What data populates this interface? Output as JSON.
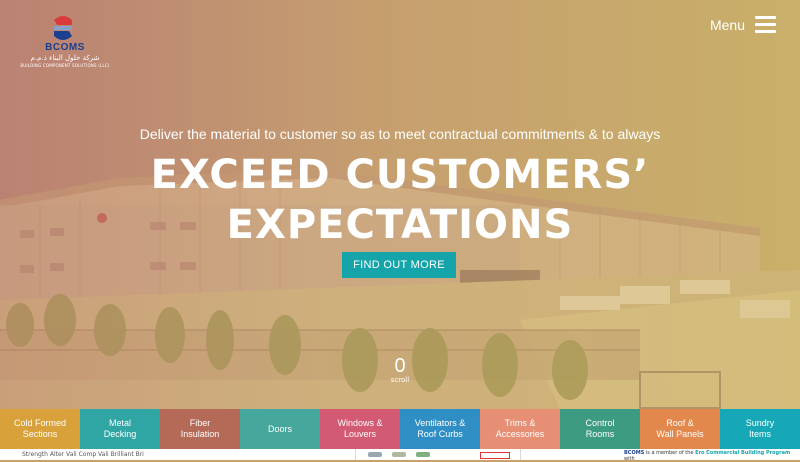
{
  "header": {
    "brand": "BCOMS",
    "arabic_name": "شركة حلول البناء ذ.م.م",
    "company_subtitle": "BUILDING COMPONENT SOLUTIONS (LLC)",
    "menu_label": "Menu"
  },
  "hero": {
    "tagline": "Deliver the material to customer so as to meet contractual commitments & to always",
    "headline_line1": "EXCEED CUSTOMERS’",
    "headline_line2": "EXPECTATIONS",
    "cta_label": "FIND OUT MORE",
    "scroll_number": "0",
    "scroll_label": "scroll"
  },
  "categories": [
    {
      "label": "Cold Formed\nSections",
      "color": "#d9a13a"
    },
    {
      "label": "Metal\nDecking",
      "color": "#2fa5a4"
    },
    {
      "label": "Fiber\nInsulation",
      "color": "#b56a57"
    },
    {
      "label": "Doors",
      "color": "#46a89c"
    },
    {
      "label": "Windows &\nLouvers",
      "color": "#d35a73"
    },
    {
      "label": "Ventilators &\nRoof Curbs",
      "color": "#2f8fc4"
    },
    {
      "label": "Trims &\nAccessories",
      "color": "#e78f74"
    },
    {
      "label": "Control\nRooms",
      "color": "#3d9b82"
    },
    {
      "label": "Roof &\nWall Panels",
      "color": "#e3884c"
    },
    {
      "label": "Sundry\nItems",
      "color": "#16a8b6"
    }
  ],
  "footer": {
    "left_text": "Strength  Alter  Vali  Comp  Vali  Brilliant  Bri",
    "right_prefix": "BCOMS",
    "right_mid": " is a member of the ",
    "right_link": "Ero Commercial Building Program",
    "right_suffix": " with"
  },
  "colors": {
    "accent": "#16a4ab",
    "brand_blue": "#1c3f8f",
    "brand_red": "#d93a3a"
  }
}
